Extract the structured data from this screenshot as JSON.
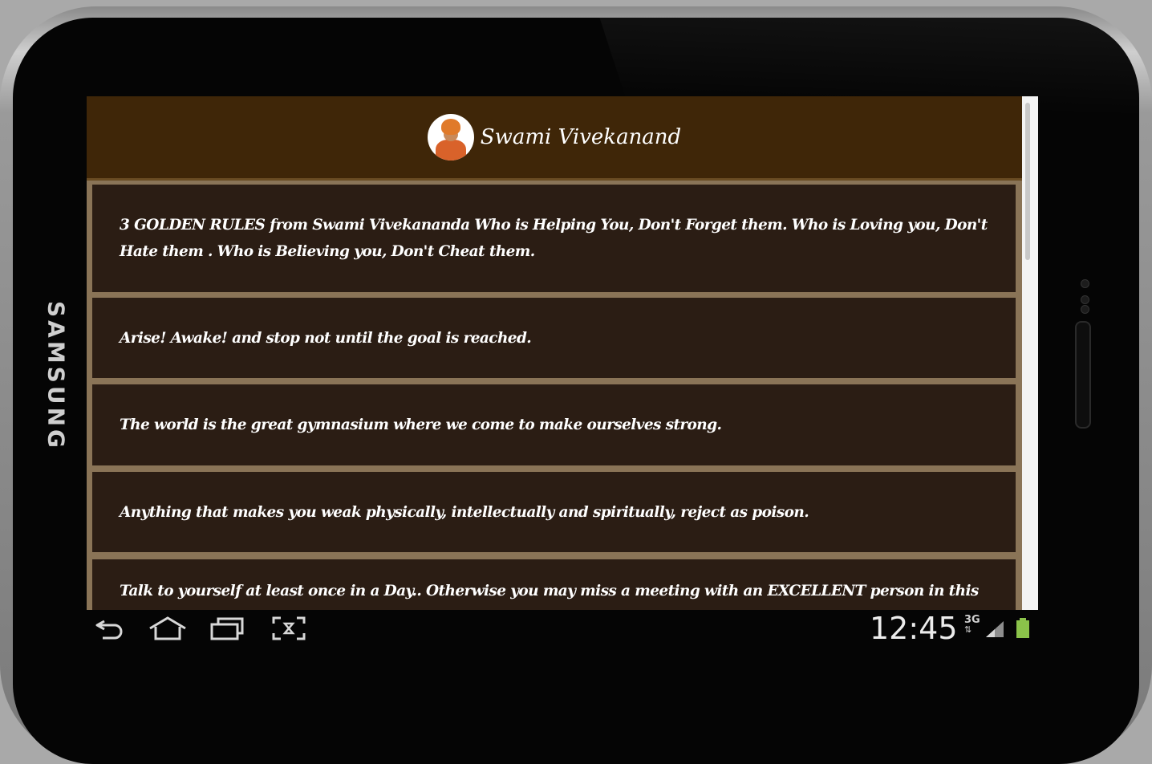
{
  "device": {
    "brand": "SAMSUNG"
  },
  "app": {
    "title": "Swami Vivekanand"
  },
  "quotes": [
    {
      "text": "3 GOLDEN RULES from Swami Vivekananda Who is Helping You, Don't Forget them. Who is Loving you, Don't Hate them . Who is Believing you, Don't Cheat them."
    },
    {
      "text": "Arise! Awake! and stop not until the goal is reached."
    },
    {
      "text": "The world is the great gymnasium where we come to make ourselves strong."
    },
    {
      "text": "Anything that makes you weak physically, intellectually and spiritually, reject as poison."
    },
    {
      "text": "Talk to yourself at least once in a Day.. Otherwise you may miss a meeting with an EXCELLENT person in this World..."
    }
  ],
  "status_bar": {
    "time": "12:45",
    "network": "3G",
    "icons": [
      "signal-icon",
      "battery-icon"
    ]
  },
  "nav_bar": {
    "icons": [
      "back-icon",
      "home-icon",
      "recent-apps-icon",
      "screenshot-icon"
    ]
  },
  "colors": {
    "header": "#3f2608",
    "card": "#2b1d14",
    "card_border": "#8a7457",
    "battery": "#8bc34a"
  }
}
